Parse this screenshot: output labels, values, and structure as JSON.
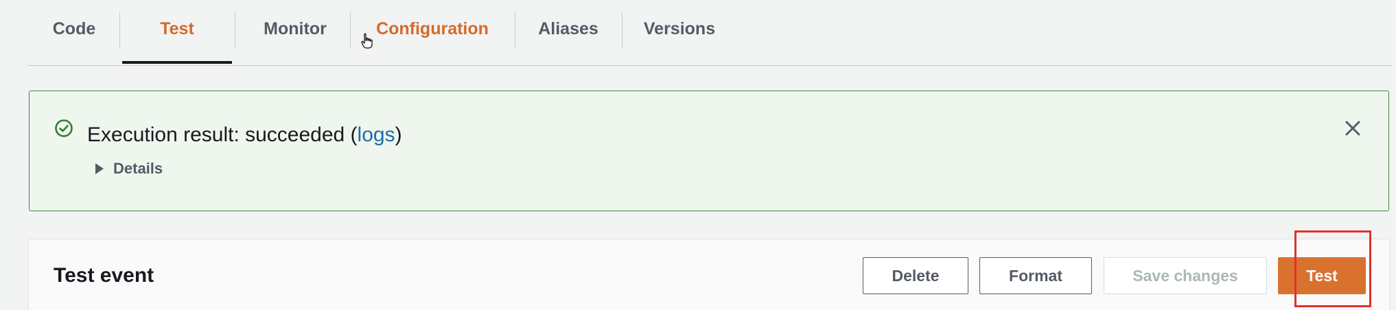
{
  "tabs": [
    {
      "label": "Code"
    },
    {
      "label": "Test"
    },
    {
      "label": "Monitor"
    },
    {
      "label": "Configuration"
    },
    {
      "label": "Aliases"
    },
    {
      "label": "Versions"
    }
  ],
  "active_tab": "Test",
  "flash": {
    "prefix": "Execution result: succeeded (",
    "link": "logs",
    "suffix": ")",
    "details": "Details",
    "status_color": "#3c8a3c"
  },
  "test_event": {
    "title": "Test event",
    "buttons": {
      "delete": "Delete",
      "format": "Format",
      "save": "Save changes",
      "test": "Test"
    }
  },
  "colors": {
    "accent": "#d36b2a",
    "primary_button": "#d9722f",
    "link": "#1c6cae",
    "highlight_box": "#e0312b"
  },
  "icons": {
    "success": "check-circle-icon",
    "close": "close-icon",
    "expand": "caret-right-icon",
    "cursor": "hand-pointer-icon"
  }
}
